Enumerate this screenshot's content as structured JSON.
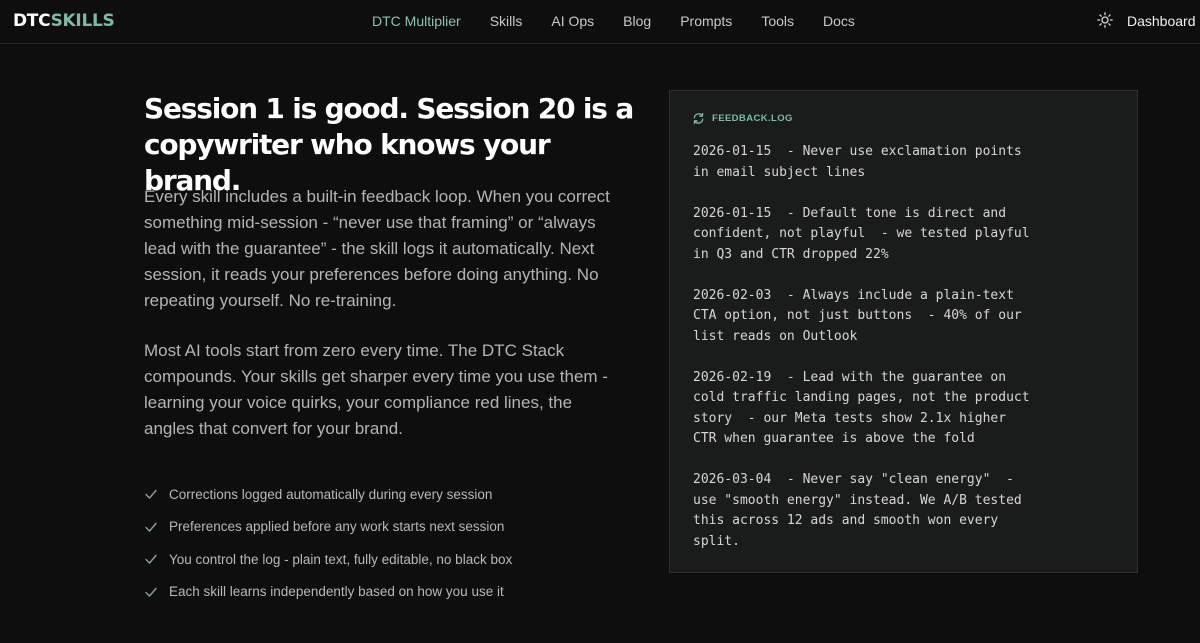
{
  "header": {
    "logo_part1": "DTC",
    "logo_part2": "SKILLS",
    "nav": [
      "DTC Multiplier",
      "Skills",
      "AI Ops",
      "Blog",
      "Prompts",
      "Tools",
      "Docs"
    ],
    "active_nav": "DTC Multiplier",
    "theme_icon": "sun-icon",
    "dashboard_label": "Dashboard"
  },
  "hero": {
    "headline": "Session 1 is good. Session 20 is a copywriter who knows your brand.",
    "paragraph1": "Every skill includes a built-in feedback loop. When you correct something mid-session - “never use that framing” or “always lead with the guarantee” - the skill logs it automatically. Next session, it reads your preferences before doing anything. No repeating yourself. No re-training.",
    "paragraph2": "Most AI tools start from zero every time. The DTC Stack compounds. Your skills get sharper every time you use them - learning your voice quirks, your compliance red lines, the angles that convert for your brand.",
    "checklist": [
      "Corrections logged automatically during every session",
      "Preferences applied before any work starts next session",
      "You control the log - plain text, fully editable, no black box",
      "Each skill learns independently based on how you use it"
    ]
  },
  "log_panel": {
    "title": "FEEDBACK.LOG",
    "entries": [
      "2026-01-15  - Never use exclamation points\nin email subject lines",
      "2026-01-15  - Default tone is direct and\nconfident, not playful  - we tested playful\nin Q3 and CTR dropped 22%",
      "2026-02-03  - Always include a plain-text\nCTA option, not just buttons  - 40% of our\nlist reads on Outlook",
      "2026-02-19  - Lead with the guarantee on\ncold traffic landing pages, not the product\nstory  - our Meta tests show 2.1x higher\nCTR when guarantee is above the fold",
      "2026-03-04  - Never say \"clean energy\"  -\nuse \"smooth energy\" instead. We A/B tested\nthis across 12 ads and smooth won every\nsplit."
    ]
  },
  "colors": {
    "background": "#0e0e0e",
    "accent": "#7fb9a4",
    "panel": "#1a1c1b"
  }
}
